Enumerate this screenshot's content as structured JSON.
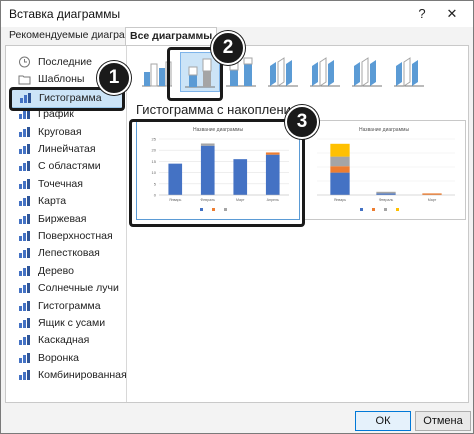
{
  "window": {
    "title": "Вставка диаграммы",
    "help_glyph": "?",
    "close_glyph": "✕"
  },
  "tabs": [
    {
      "label": "Рекомендуемые диаграммы",
      "active": false
    },
    {
      "label": "Все диаграммы",
      "active": true
    }
  ],
  "sidebar": {
    "items": [
      {
        "label": "Последние",
        "icon": "recent-icon"
      },
      {
        "label": "Шаблоны",
        "icon": "folder-icon"
      },
      {
        "label": "Гистограмма",
        "icon": "column-chart-icon",
        "selected": true
      },
      {
        "label": "График",
        "icon": "line-chart-icon"
      },
      {
        "label": "Круговая",
        "icon": "pie-chart-icon"
      },
      {
        "label": "Линейчатая",
        "icon": "bar-chart-icon"
      },
      {
        "label": "С областями",
        "icon": "area-chart-icon"
      },
      {
        "label": "Точечная",
        "icon": "scatter-chart-icon"
      },
      {
        "label": "Карта",
        "icon": "map-chart-icon"
      },
      {
        "label": "Биржевая",
        "icon": "stock-chart-icon"
      },
      {
        "label": "Поверхностная",
        "icon": "surface-chart-icon"
      },
      {
        "label": "Лепестковая",
        "icon": "radar-chart-icon"
      },
      {
        "label": "Дерево",
        "icon": "treemap-icon"
      },
      {
        "label": "Солнечные лучи",
        "icon": "sunburst-icon"
      },
      {
        "label": "Гистограмма",
        "icon": "histogram-icon"
      },
      {
        "label": "Ящик с усами",
        "icon": "box-whisker-icon"
      },
      {
        "label": "Каскадная",
        "icon": "waterfall-icon"
      },
      {
        "label": "Воронка",
        "icon": "funnel-icon"
      },
      {
        "label": "Комбинированная",
        "icon": "combo-chart-icon"
      }
    ]
  },
  "subtypes": [
    {
      "name": "clustered-column",
      "selected": false
    },
    {
      "name": "stacked-column",
      "selected": true
    },
    {
      "name": "100-stacked-column",
      "selected": false
    },
    {
      "name": "3d-clustered-column",
      "selected": false
    },
    {
      "name": "3d-stacked-column",
      "selected": false
    },
    {
      "name": "3d-100-stacked-column",
      "selected": false
    },
    {
      "name": "3d-column",
      "selected": false
    }
  ],
  "section_title": "Гистограмма с накоплением",
  "colors": {
    "series1": "#4472c4",
    "series2": "#ed7d31",
    "series3": "#a5a5a5",
    "series4": "#ffc000",
    "accent": "#0078d7"
  },
  "chart_data": [
    {
      "type": "bar",
      "stacked": true,
      "title": "Название диаграммы",
      "categories": [
        "Январь",
        "Февраль",
        "Март",
        "Апрель"
      ],
      "series": [
        {
          "values": [
            14,
            22,
            16,
            18
          ]
        },
        {
          "values": [
            0,
            0,
            0,
            1
          ]
        },
        {
          "values": [
            0,
            1,
            0,
            0
          ]
        }
      ],
      "ylim": [
        0,
        25
      ],
      "yticks": [
        "0",
        "5",
        "10",
        "15",
        "20",
        "25"
      ]
    },
    {
      "type": "bar",
      "stacked": true,
      "title": "Название диаграммы",
      "categories": [
        "Январь",
        "Февраль",
        "Март"
      ],
      "series": [
        {
          "values": [
            14,
            1,
            0
          ]
        },
        {
          "values": [
            4,
            0,
            1
          ]
        },
        {
          "values": [
            6,
            1,
            0
          ]
        },
        {
          "values": [
            8,
            0,
            0
          ]
        }
      ],
      "ylim": [
        0,
        35
      ]
    }
  ],
  "callouts": [
    "1",
    "2",
    "3"
  ],
  "buttons": {
    "ok": "ОК",
    "cancel": "Отмена"
  }
}
